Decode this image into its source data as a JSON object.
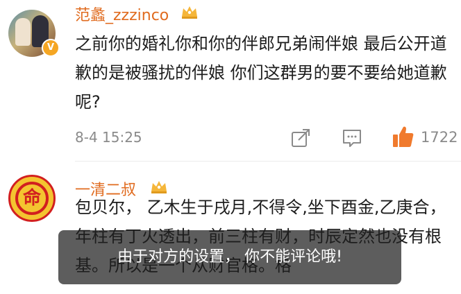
{
  "comments": [
    {
      "username": "范蠡_zzzinco",
      "text": "之前你的婚礼你和你的伴郎兄弟闹伴娘 最后公开道歉的是被骚扰的伴娘 你们这群男的要不要给她道歉呢?",
      "time": "8-4 15:25",
      "likes": "1722",
      "avatar_icon": "user-photo-avatar",
      "badge_icon": "verified-badge-icon",
      "crown_icon": "vip-crown-icon"
    },
    {
      "username": "一清二叔",
      "text": "包贝尔， 乙木生于戌月,不得令,坐下酉金,乙庚合，年柱有丁火透出，前三柱有财，时辰定然也没有根基。所以是一个从财官格。格",
      "avatar_glyph": "命",
      "crown_icon": "vip-crown-icon"
    }
  ],
  "actions": {
    "share_icon": "share-icon",
    "comment_icon": "comment-icon",
    "like_icon": "thumbs-up-icon"
  },
  "toast": {
    "message": "由于对方的设置， 你不能评论哦!"
  },
  "colors": {
    "username": "#e06b1f",
    "like_accent": "#f07a2d",
    "meta": "#8a8a8a"
  }
}
